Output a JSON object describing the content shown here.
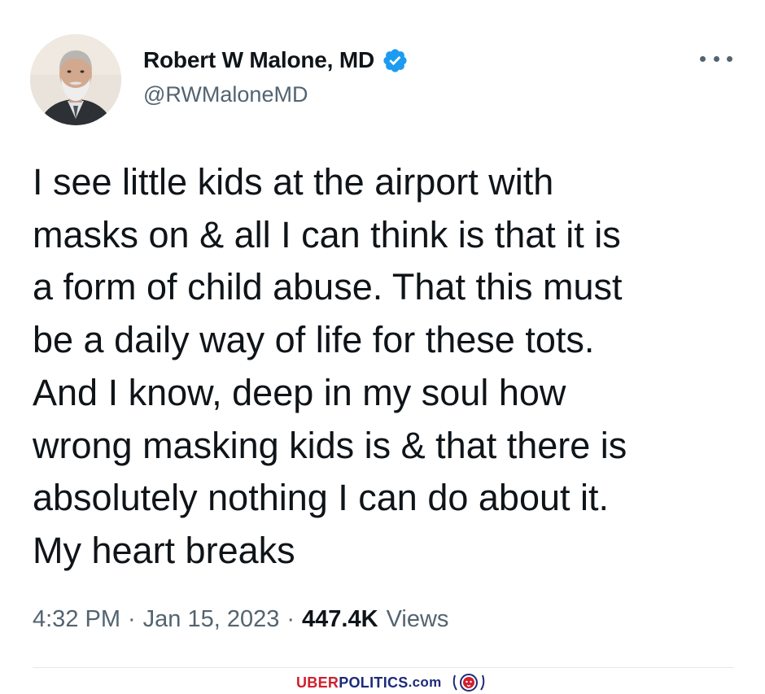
{
  "author": {
    "display_name": "Robert W Malone, MD",
    "handle": "@RWMaloneMD",
    "verified": true
  },
  "tweet": {
    "lines": [
      "I see little kids at the airport with",
      "masks on & all I can think is that it is",
      "a form of child abuse. That this must",
      "be a daily way of life for these tots.",
      "And I know, deep in my soul how",
      "wrong masking kids is & that there is",
      "absolutely nothing I can do about it.",
      "My heart breaks"
    ]
  },
  "meta": {
    "time": "4:32 PM",
    "separator": "·",
    "date": "Jan 15, 2023",
    "views_count": "447.4K",
    "views_label": "Views"
  },
  "watermark": {
    "uber": "UBER",
    "politics": "POLITICS",
    "dotcom": ".com"
  },
  "icons": {
    "verified": "verified-badge-icon",
    "more": "more-dots-icon",
    "logo": "lion-crest-logo"
  },
  "colors": {
    "text_primary": "#0f1419",
    "text_secondary": "#536471",
    "verified_blue": "#1d9bf0",
    "watermark_red": "#d11f2d",
    "watermark_navy": "#1d2a7a"
  }
}
